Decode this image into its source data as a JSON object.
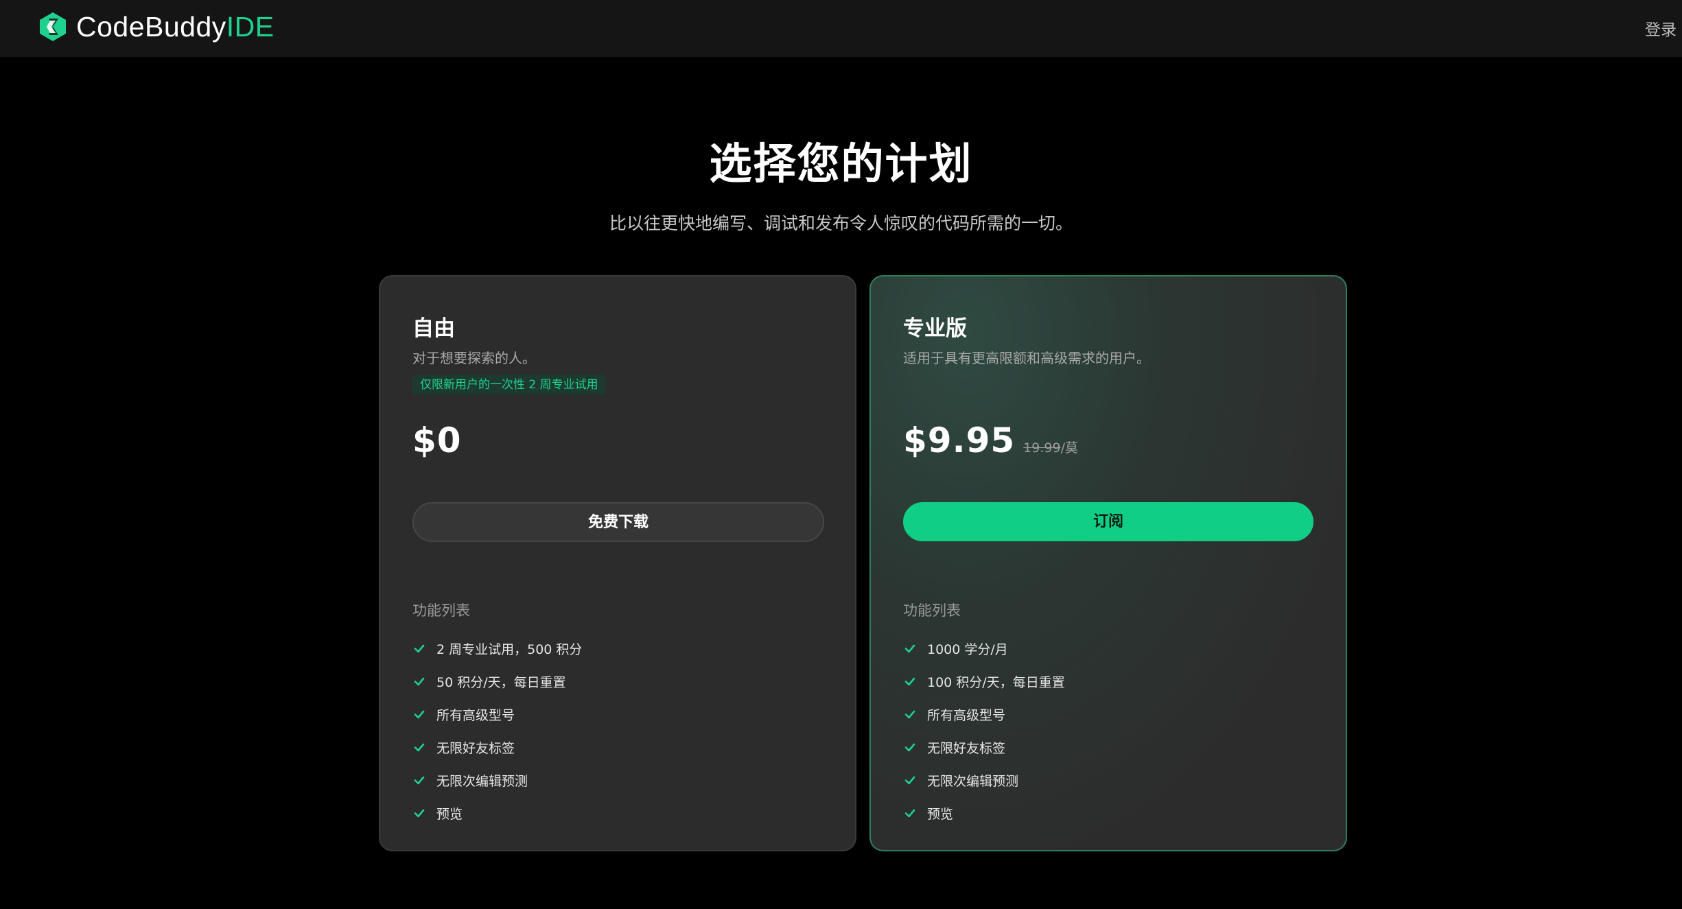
{
  "header": {
    "logo_text": "CodeBuddy",
    "logo_suffix": "IDE",
    "login_label": "登录"
  },
  "hero": {
    "title": "选择您的计划",
    "subtitle": "比以往更快地编写、调试和发布令人惊叹的代码所需的一切。"
  },
  "plans": [
    {
      "name": "自由",
      "description": "对于想要探索的人。",
      "badge": "仅限新用户的一次性 2 周专业试用",
      "price": "$0",
      "button_label": "免费下载",
      "features_title": "功能列表",
      "features": [
        "2 周专业试用，500 积分",
        "50 积分/天，每日重置",
        "所有高级型号",
        "无限好友标签",
        "无限次编辑预测",
        "预览"
      ]
    },
    {
      "name": "专业版",
      "description": "适用于具有更高限额和高级需求的用户。",
      "price": "$9.95",
      "old_price": "19.99",
      "price_period": "/莫",
      "button_label": "订阅",
      "features_title": "功能列表",
      "features": [
        "1000 学分/月",
        "100 积分/天，每日重置",
        "所有高级型号",
        "无限好友标签",
        "无限次编辑预测",
        "预览"
      ]
    }
  ],
  "icons": {
    "logo": "codebuddy-logo-icon",
    "feature_check": "check-icon"
  },
  "colors": {
    "accent": "#1fd18f",
    "button_primary": "#10cf85",
    "background": "#000000",
    "card": "#2c2c2c"
  }
}
